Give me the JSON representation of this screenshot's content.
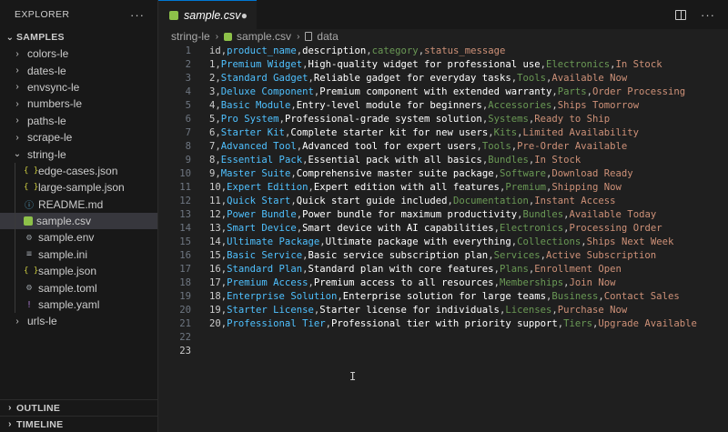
{
  "sidebar": {
    "title": "EXPLORER",
    "more": "···",
    "root": "SAMPLES",
    "folders_top": [
      "colors-le",
      "dates-le",
      "envsync-le",
      "numbers-le",
      "paths-le",
      "scrape-le"
    ],
    "open_folder": "string-le",
    "files": [
      {
        "name": "edge-cases.json",
        "icon": "json-icon"
      },
      {
        "name": "large-sample.json",
        "icon": "json-icon"
      },
      {
        "name": "README.md",
        "icon": "info-icon"
      },
      {
        "name": "sample.csv",
        "icon": "csv-icon"
      },
      {
        "name": "sample.env",
        "icon": "gear-icon"
      },
      {
        "name": "sample.ini",
        "icon": "lines-icon"
      },
      {
        "name": "sample.json",
        "icon": "json-icon"
      },
      {
        "name": "sample.toml",
        "icon": "toml-icon"
      },
      {
        "name": "sample.yaml",
        "icon": "yaml-icon"
      }
    ],
    "folders_bottom": [
      "urls-le"
    ],
    "outline": "OUTLINE",
    "timeline": "TIMELINE"
  },
  "tab": {
    "label": "sample.csv",
    "close": "●"
  },
  "breadcrumb": {
    "folder": "string-le",
    "file": "sample.csv",
    "symbol": "data"
  },
  "colors": {
    "id": "#cccccc",
    "name": "#4fc1ff",
    "desc": "#ffffff",
    "category": "#6a9955",
    "status": "#ce9178"
  },
  "editor": {
    "active_line": 23,
    "header": [
      "id",
      "product_name",
      "description",
      "category",
      "status_message"
    ],
    "rows": [
      [
        "1",
        "Premium Widget",
        "High-quality widget for professional use",
        "Electronics",
        "In Stock"
      ],
      [
        "2",
        "Standard Gadget",
        "Reliable gadget for everyday tasks",
        "Tools",
        "Available Now"
      ],
      [
        "3",
        "Deluxe Component",
        "Premium component with extended warranty",
        "Parts",
        "Order Processing"
      ],
      [
        "4",
        "Basic Module",
        "Entry-level module for beginners",
        "Accessories",
        "Ships Tomorrow"
      ],
      [
        "5",
        "Pro System",
        "Professional-grade system solution",
        "Systems",
        "Ready to Ship"
      ],
      [
        "6",
        "Starter Kit",
        "Complete starter kit for new users",
        "Kits",
        "Limited Availability"
      ],
      [
        "7",
        "Advanced Tool",
        "Advanced tool for expert users",
        "Tools",
        "Pre-Order Available"
      ],
      [
        "8",
        "Essential Pack",
        "Essential pack with all basics",
        "Bundles",
        "In Stock"
      ],
      [
        "9",
        "Master Suite",
        "Comprehensive master suite package",
        "Software",
        "Download Ready"
      ],
      [
        "10",
        "Expert Edition",
        "Expert edition with all features",
        "Premium",
        "Shipping Now"
      ],
      [
        "11",
        "Quick Start",
        "Quick start guide included",
        "Documentation",
        "Instant Access"
      ],
      [
        "12",
        "Power Bundle",
        "Power bundle for maximum productivity",
        "Bundles",
        "Available Today"
      ],
      [
        "13",
        "Smart Device",
        "Smart device with AI capabilities",
        "Electronics",
        "Processing Order"
      ],
      [
        "14",
        "Ultimate Package",
        "Ultimate package with everything",
        "Collections",
        "Ships Next Week"
      ],
      [
        "15",
        "Basic Service",
        "Basic service subscription plan",
        "Services",
        "Active Subscription"
      ],
      [
        "16",
        "Standard Plan",
        "Standard plan with core features",
        "Plans",
        "Enrollment Open"
      ],
      [
        "17",
        "Premium Access",
        "Premium access to all resources",
        "Memberships",
        "Join Now"
      ],
      [
        "18",
        "Enterprise Solution",
        "Enterprise solution for large teams",
        "Business",
        "Contact Sales"
      ],
      [
        "19",
        "Starter License",
        "Starter license for individuals",
        "Licenses",
        "Purchase Now"
      ],
      [
        "20",
        "Professional Tier",
        "Professional tier with priority support",
        "Tiers",
        "Upgrade Available"
      ]
    ],
    "total_lines": 23
  }
}
